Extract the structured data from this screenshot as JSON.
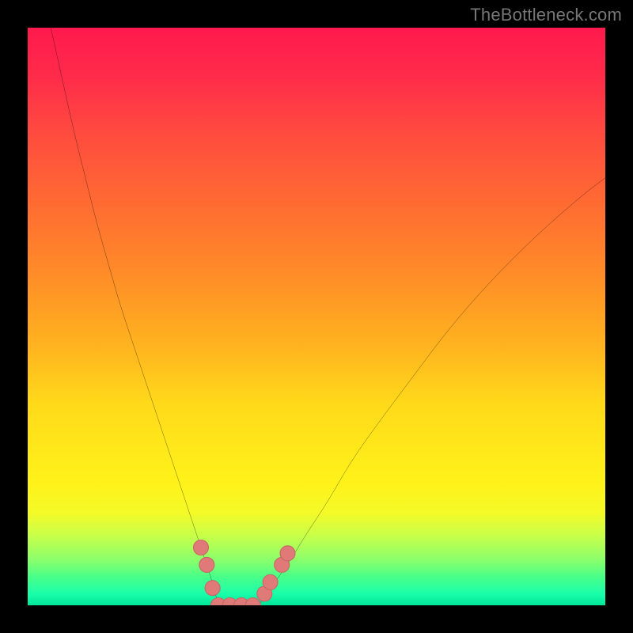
{
  "watermark": "TheBottleneck.com",
  "colors": {
    "background_frame": "#000000",
    "gradient_top": "#ff1a4d",
    "gradient_bottom": "#00e59a",
    "curve_stroke": "#000000",
    "marker_fill": "#e07a78",
    "marker_stroke": "#c86665"
  },
  "chart_data": {
    "type": "line",
    "title": "",
    "xlabel": "",
    "ylabel": "",
    "xlim": [
      0,
      100
    ],
    "ylim": [
      0,
      100
    ],
    "grid": false,
    "legend": false,
    "series": [
      {
        "name": "left-branch",
        "x": [
          4,
          6,
          8,
          10,
          12,
          14,
          16,
          18,
          20,
          22,
          24,
          26,
          28,
          30,
          32,
          33
        ],
        "values": [
          100,
          91,
          82,
          74,
          66,
          59,
          52,
          46,
          40,
          34,
          28,
          22,
          16,
          10,
          4,
          0
        ]
      },
      {
        "name": "right-branch",
        "x": [
          40,
          42,
          45,
          48,
          52,
          56,
          61,
          67,
          73,
          80,
          88,
          96,
          100
        ],
        "values": [
          0,
          3,
          7,
          12,
          18,
          25,
          32,
          40,
          48,
          56,
          64,
          71,
          74
        ]
      },
      {
        "name": "floor-segment",
        "x": [
          33,
          34,
          35,
          36,
          37,
          38,
          39,
          40
        ],
        "values": [
          0,
          0,
          0,
          0,
          0,
          0,
          0,
          0
        ]
      }
    ],
    "markers": [
      {
        "series": "left-branch",
        "x": 30,
        "y": 10
      },
      {
        "series": "left-branch",
        "x": 31,
        "y": 7
      },
      {
        "series": "left-branch",
        "x": 32,
        "y": 3
      },
      {
        "series": "floor-segment",
        "x": 33,
        "y": 0
      },
      {
        "series": "floor-segment",
        "x": 35,
        "y": 0
      },
      {
        "series": "floor-segment",
        "x": 37,
        "y": 0
      },
      {
        "series": "floor-segment",
        "x": 39,
        "y": 0
      },
      {
        "series": "right-branch",
        "x": 41,
        "y": 2
      },
      {
        "series": "right-branch",
        "x": 42,
        "y": 4
      },
      {
        "series": "right-branch",
        "x": 44,
        "y": 7
      },
      {
        "series": "right-branch",
        "x": 45,
        "y": 9
      }
    ]
  }
}
